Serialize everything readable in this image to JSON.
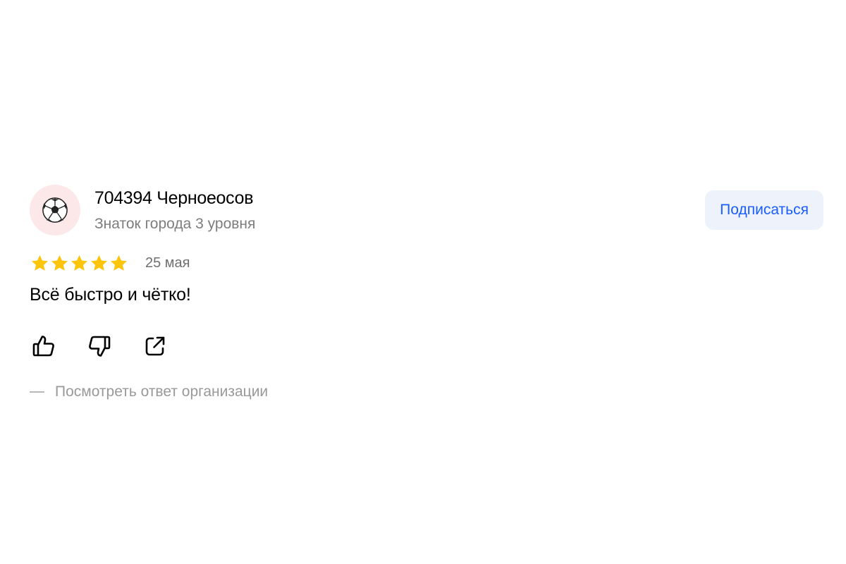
{
  "review": {
    "author": {
      "avatar_icon": "soccer-ball-icon",
      "avatar_bg": "#fce8e8",
      "name": "704394 Черноеосов",
      "level": "Знаток города 3 уровня"
    },
    "subscribe_label": "Подписаться",
    "rating": {
      "value": 5,
      "max": 5,
      "star_color": "#fcc40a"
    },
    "date": "25 мая",
    "text": "Всё быстро и чётко!",
    "actions": {
      "like_icon": "thumbs-up-icon",
      "dislike_icon": "thumbs-down-icon",
      "share_icon": "share-icon"
    },
    "org_reply_label": "Посмотреть ответ организации"
  },
  "colors": {
    "accent": "#1a5cff",
    "button_bg": "#eef2fa",
    "secondary_text": "#7d7d7d",
    "muted_text": "#999999"
  }
}
